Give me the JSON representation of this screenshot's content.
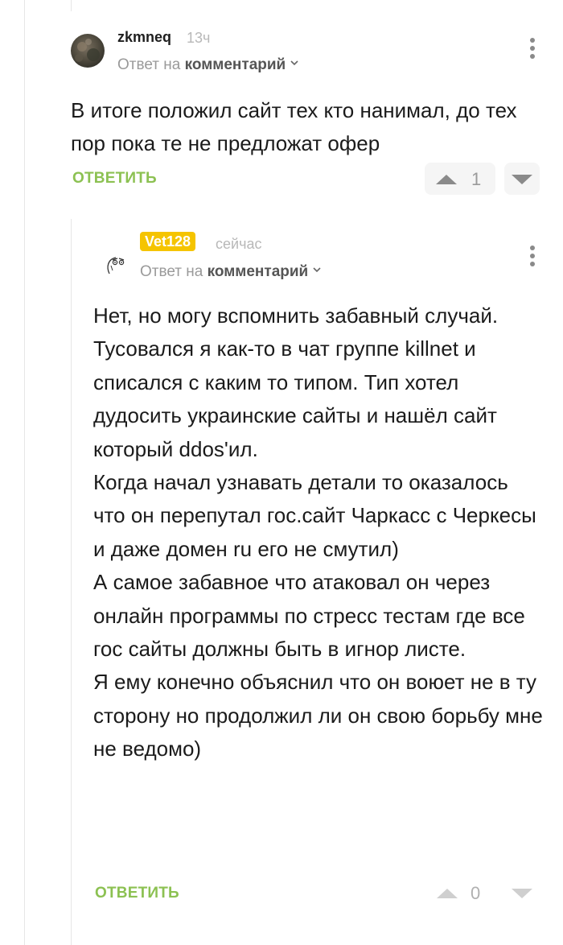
{
  "comments": [
    {
      "author": "zkmneq",
      "time": "13ч",
      "reply_prefix": "Ответ на",
      "reply_target": "комментарий",
      "text": "В итоге положил сайт тех кто нанимал, до тех пор пока те не предложат офер",
      "reply_label": "ОТВЕТИТЬ",
      "rating": "1",
      "icons": [
        "avatar-photo",
        "chevron-down-icon",
        "more-vertical-icon",
        "arrow-up-icon",
        "arrow-down-icon"
      ]
    },
    {
      "author": "Vet128",
      "time": "сейчас",
      "reply_prefix": "Ответ на",
      "reply_target": "комментарий",
      "text": "Нет, но могу вспомнить забавный случай.\nТусовался я как-то в чат группе killnet и списался с каким то типом. Тип хотел дудосить украинские сайты и нашёл сайт который ddos'ил.\nКогда начал узнавать детали то оказалось что он перепутал гос.сайт Чаркасс с Черкесы и даже домен ru его не смутил)\nА самое забавное что атаковал он через онлайн программы по стресс тестам где все гос сайты должны быть в игнор листе.\nЯ ему конечно объяснил что он воюет не в ту сторону но продолжил ли он свою борьбу мне не ведомо)",
      "reply_label": "ОТВЕТИТЬ",
      "rating": "0",
      "badge_color": "#f5c400"
    }
  ],
  "colors": {
    "accent_green": "#8cc152",
    "muted_text": "#9a9a9a",
    "badge_yellow": "#f5c400"
  }
}
